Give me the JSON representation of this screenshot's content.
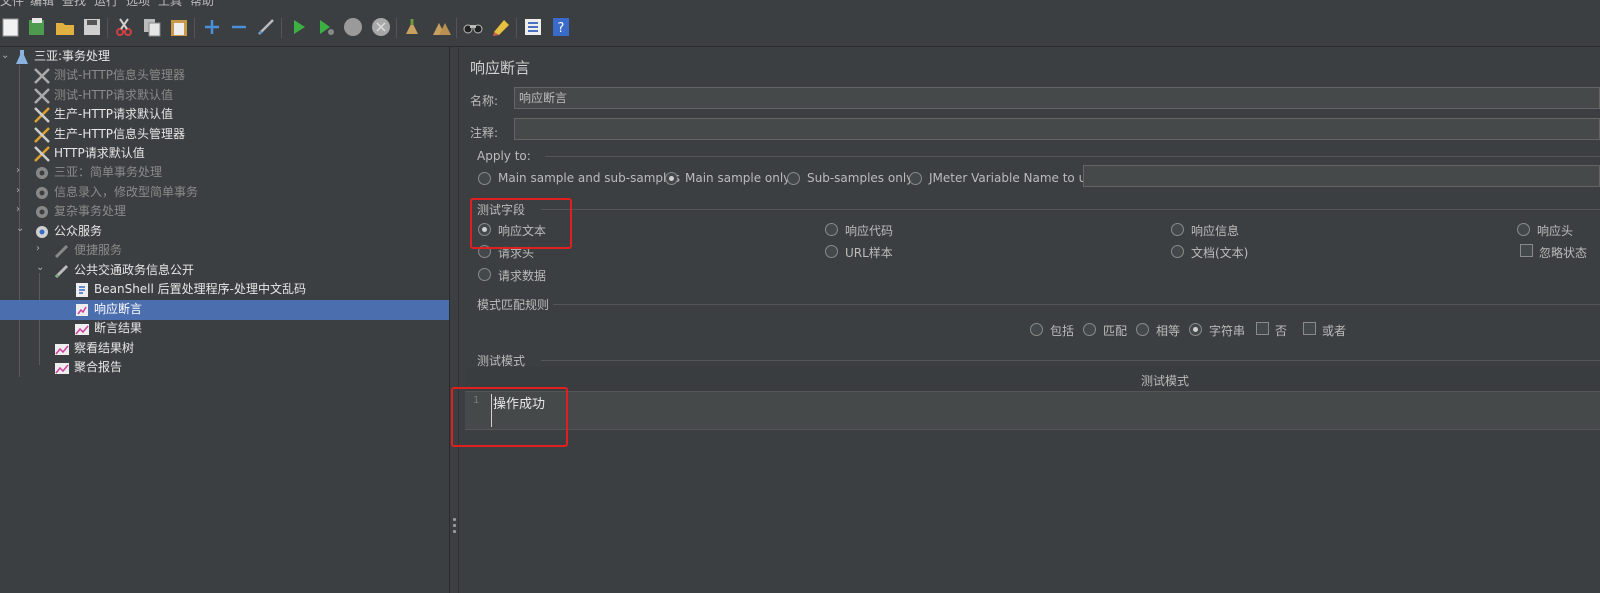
{
  "menu": [
    "文件",
    "编辑",
    "查找",
    "运行",
    "选项",
    "工具",
    "帮助"
  ],
  "toolbar": {
    "icons": [
      "new-icon",
      "templates-icon",
      "open-icon",
      "save-icon",
      "cut-icon",
      "copy-icon",
      "paste-icon",
      "expand-icon",
      "collapse-icon",
      "toggle-icon",
      "start-icon",
      "start-no-pause-icon",
      "stop-icon",
      "shutdown-icon",
      "clear-icon",
      "clear-all-icon",
      "search-icon",
      "reset-search-icon",
      "function-helper-icon",
      "help-icon"
    ]
  },
  "tree": {
    "nodes": [
      {
        "label": "三亚:事务处理",
        "icon": "test-plan-icon",
        "style": "bright"
      },
      {
        "label": "测试-HTTP信息头管理器",
        "icon": "config-icon",
        "style": "dim"
      },
      {
        "label": "测试-HTTP请求默认值",
        "icon": "config-icon",
        "style": "dim"
      },
      {
        "label": "生产-HTTP请求默认值",
        "icon": "config-icon",
        "style": "bright"
      },
      {
        "label": "生产-HTTP信息头管理器",
        "icon": "config-icon",
        "style": "bright"
      },
      {
        "label": "HTTP请求默认值",
        "icon": "config-icon",
        "style": "bright"
      },
      {
        "label": "三亚：简单事务处理",
        "icon": "thread-group-icon",
        "style": "dim"
      },
      {
        "label": "信息录入，修改型简单事务",
        "icon": "thread-group-icon",
        "style": "dim"
      },
      {
        "label": "复杂事务处理",
        "icon": "thread-group-icon",
        "style": "dim"
      },
      {
        "label": "公众服务",
        "icon": "thread-group-icon",
        "style": "bright"
      },
      {
        "label": "便捷服务",
        "icon": "sampler-icon",
        "style": "dim"
      },
      {
        "label": "公共交通政务信息公开",
        "icon": "sampler-icon",
        "style": "bright"
      },
      {
        "label": "BeanShell 后置处理程序-处理中文乱码",
        "icon": "script-icon",
        "style": "bright"
      },
      {
        "label": "响应断言",
        "icon": "assertion-icon",
        "style": "selected"
      },
      {
        "label": "断言结果",
        "icon": "listener-icon",
        "style": "bright"
      },
      {
        "label": "察看结果树",
        "icon": "listener-icon",
        "style": "bright"
      },
      {
        "label": "聚合报告",
        "icon": "listener-icon",
        "style": "bright"
      }
    ]
  },
  "panel": {
    "title": "响应断言",
    "name_label": "名称:",
    "name_value": "响应断言",
    "comment_label": "注释:",
    "comment_value": "",
    "apply_to": {
      "title": "Apply to:",
      "options": [
        "Main sample and sub-samples",
        "Main sample only",
        "Sub-samples only",
        "JMeter Variable Name to use"
      ],
      "selected": "Main sample only",
      "variable_value": ""
    },
    "field_to_test": {
      "title": "测试字段",
      "options": [
        "响应文本",
        "响应代码",
        "响应信息",
        "响应头",
        "请求头",
        "URL样本",
        "文档(文本)",
        "忽略状态",
        "请求数据"
      ],
      "selected": "响应文本"
    },
    "pattern_rules": {
      "title": "模式匹配规则",
      "radios": [
        "包括",
        "匹配",
        "相等",
        "字符串"
      ],
      "selected": "字符串",
      "checks": [
        "否",
        "或者"
      ]
    },
    "patterns": {
      "title": "测试模式",
      "column_header": "测试模式",
      "rows": [
        {
          "line": "1",
          "text": "操作成功"
        }
      ]
    }
  },
  "colors": {
    "background": "#3c3f41",
    "selection": "#4b6eaf",
    "highlight": "#e02020"
  }
}
